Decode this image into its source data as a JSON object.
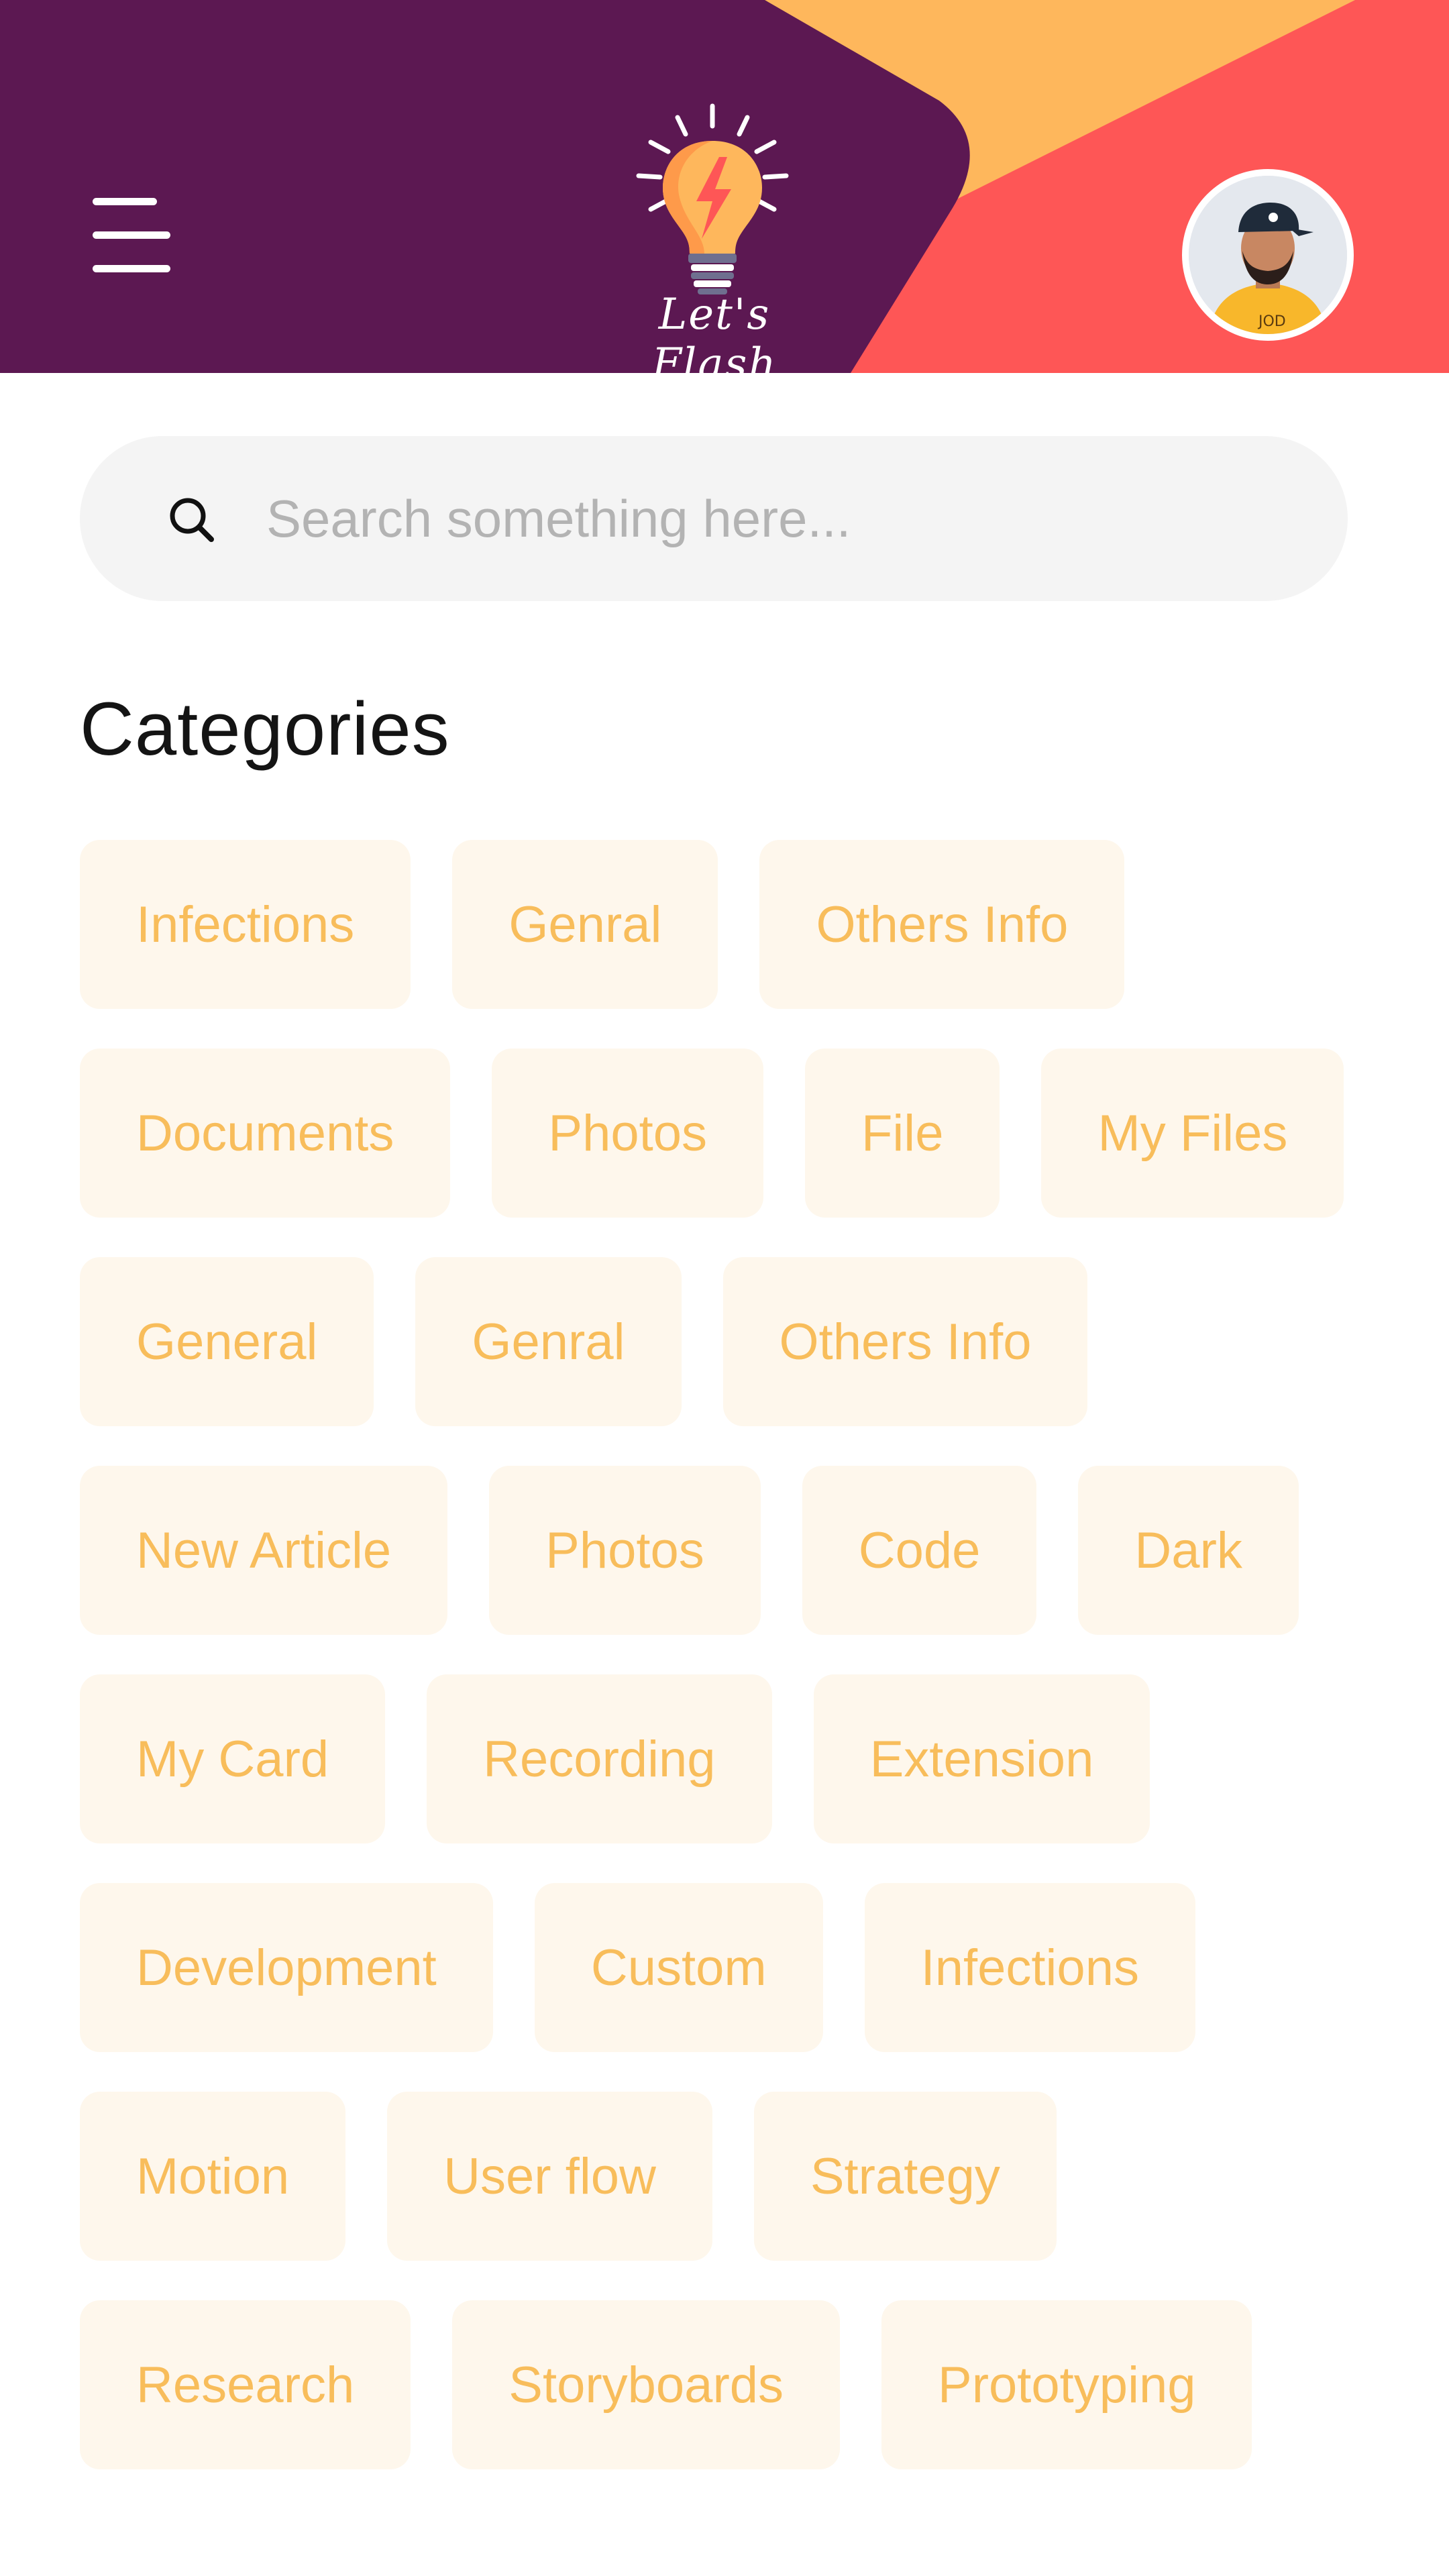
{
  "header": {
    "menu_icon": "hamburger-menu-icon",
    "logo_text": "Let's Flash",
    "logo_icon": "lightbulb-flash-icon",
    "avatar_icon": "user-avatar",
    "colors": {
      "purple": "#5c1852",
      "orange": "#feb75c",
      "red": "#fe5656"
    }
  },
  "search": {
    "placeholder": "Search something here...",
    "value": "",
    "icon": "search-icon"
  },
  "categories": {
    "title": "Categories",
    "chip_text_color": "#f8bd5b",
    "chip_bg_color": "#fef7ec",
    "rows": [
      [
        "Infections",
        "Genral",
        "Others Info"
      ],
      [
        "Documents",
        "Photos",
        "File",
        "My Files"
      ],
      [
        "General",
        "Genral",
        "Others Info"
      ],
      [
        "New Article",
        "Photos",
        "Code",
        "Dark"
      ],
      [
        "My Card",
        "Recording",
        "Extension"
      ],
      [
        "Development",
        "Custom",
        "Infections"
      ],
      [
        "Motion",
        "User flow",
        "Strategy"
      ],
      [
        "Research",
        "Storyboards",
        "Prototyping"
      ]
    ]
  }
}
